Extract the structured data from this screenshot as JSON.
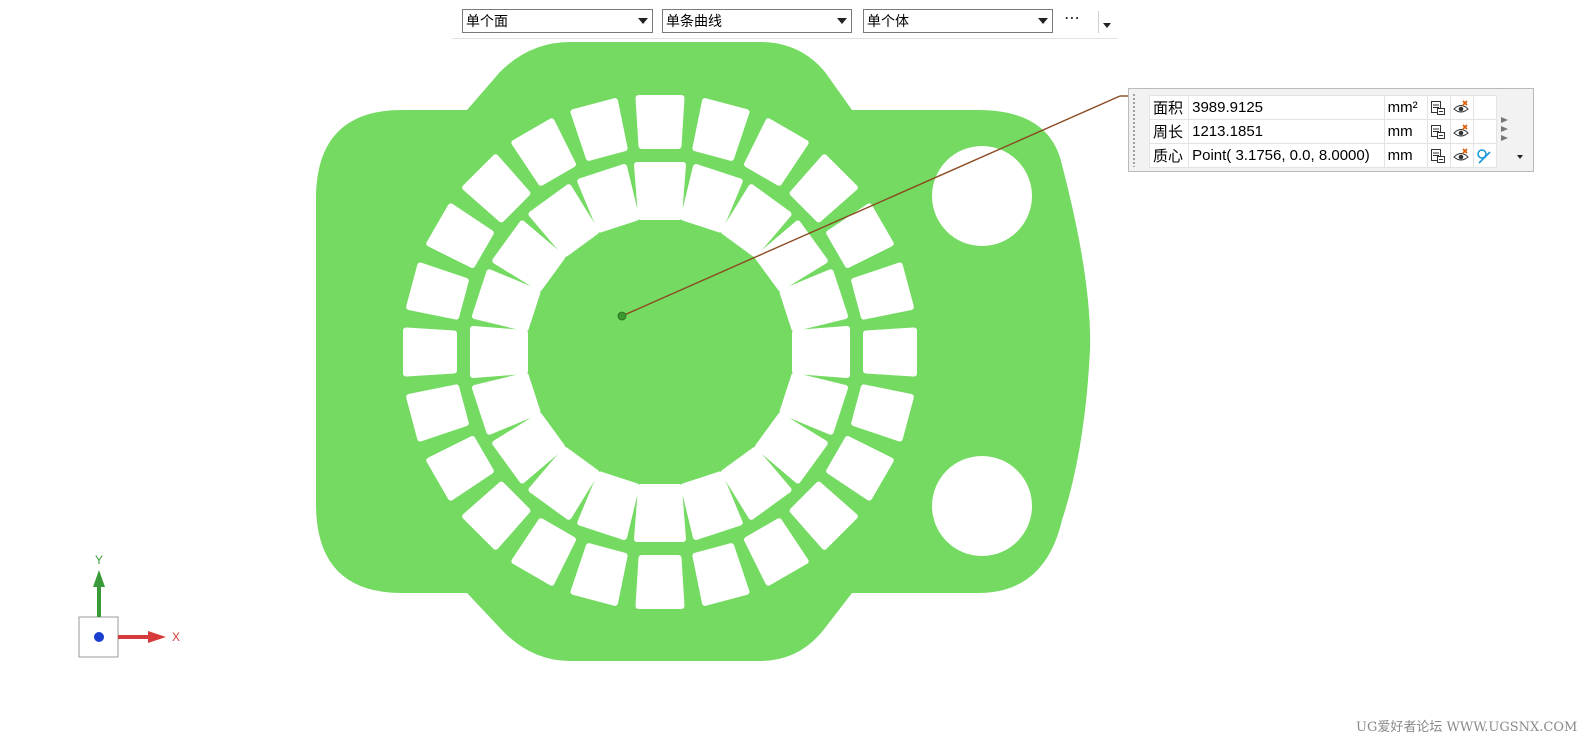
{
  "toolbar": {
    "face_filter": "单个面",
    "curve_filter": "单条曲线",
    "body_filter": "单个体",
    "more_label": "⋯"
  },
  "measure": {
    "rows": [
      {
        "label": "面积",
        "value": "3989.9125",
        "unit": "mm²"
      },
      {
        "label": "周长",
        "value": "1213.1851",
        "unit": "mm"
      },
      {
        "label": "质心",
        "value": "Point( 3.1756, 0.0, 8.0000)",
        "unit": "mm"
      }
    ]
  },
  "triad": {
    "x_label": "X",
    "y_label": "Y"
  },
  "watermark": "UG爱好者论坛 WWW.UGSNX.COM",
  "colors": {
    "part": "#74da62",
    "leader": "#8b4a20",
    "x_axis": "#d63a3a",
    "y_axis": "#3a9a3a",
    "z_axis": "#1a3fd0"
  }
}
